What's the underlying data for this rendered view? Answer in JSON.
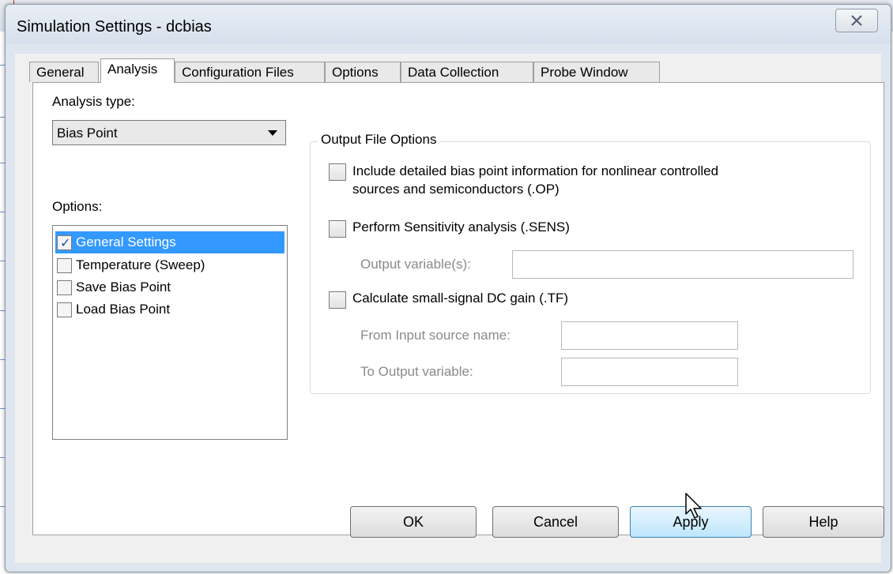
{
  "window": {
    "title": "Simulation Settings - dcbias"
  },
  "tabs": [
    {
      "label": "General"
    },
    {
      "label": "Analysis"
    },
    {
      "label": "Configuration Files"
    },
    {
      "label": "Options"
    },
    {
      "label": "Data Collection"
    },
    {
      "label": "Probe Window"
    }
  ],
  "active_tab": "Analysis",
  "analysis_type": {
    "label": "Analysis type:",
    "value": "Bias Point"
  },
  "options": {
    "label": "Options:",
    "items": [
      {
        "label": "General Settings",
        "checked": true,
        "selected": true
      },
      {
        "label": "Temperature (Sweep)",
        "checked": false,
        "selected": false
      },
      {
        "label": "Save Bias Point",
        "checked": false,
        "selected": false
      },
      {
        "label": "Load Bias Point",
        "checked": false,
        "selected": false
      }
    ]
  },
  "output_file_options": {
    "title": "Output File Options",
    "op_label_line1": "Include detailed bias point information for nonlinear controlled",
    "op_label_line2": "sources and semiconductors (.OP)",
    "sens_label": "Perform Sensitivity analysis (.SENS)",
    "sens_output_label": "Output variable(s):",
    "sens_output_value": "",
    "tf_label": "Calculate small-signal DC gain (.TF)",
    "tf_from_label": "From Input source name:",
    "tf_from_value": "",
    "tf_to_label": "To Output variable:",
    "tf_to_value": ""
  },
  "buttons": {
    "ok": "OK",
    "cancel": "Cancel",
    "apply": "Apply",
    "help": "Help"
  },
  "colors": {
    "selection": "#3399ff",
    "disabled_text": "#8a8a8a",
    "focus_button": "#bee6fd"
  }
}
